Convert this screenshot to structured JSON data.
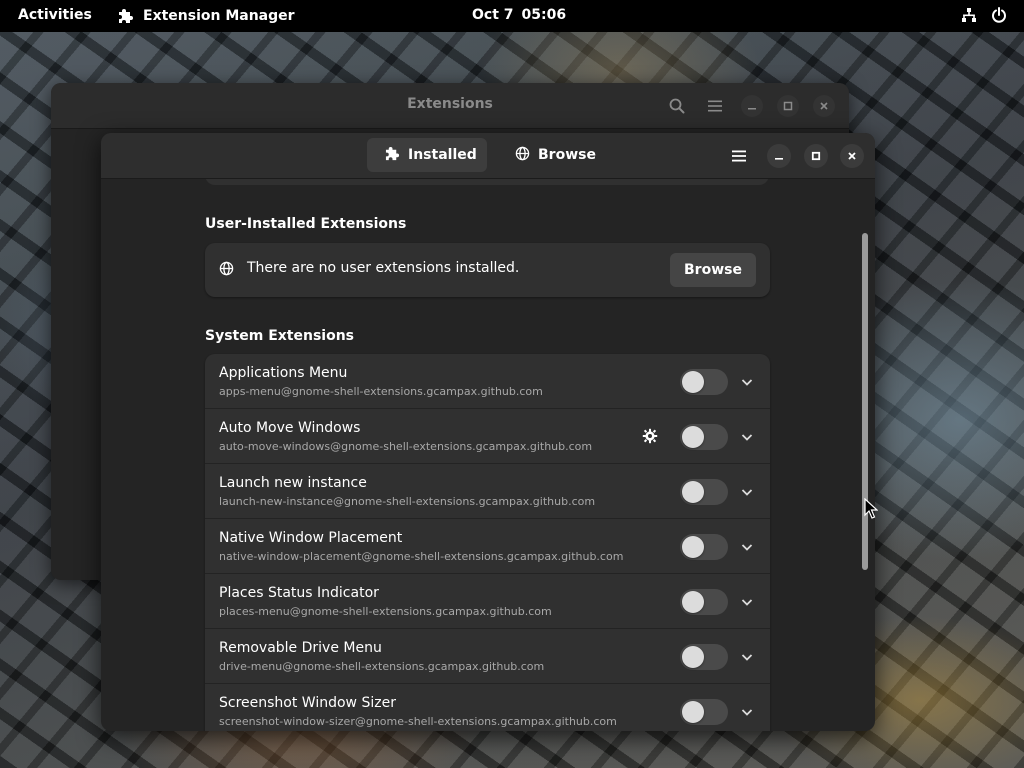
{
  "topbar": {
    "activities": "Activities",
    "app_name": "Extension Manager",
    "date": "Oct 7",
    "time": "05:06",
    "icons": [
      "puzzle-icon",
      "network-icon",
      "power-icon"
    ]
  },
  "back_window": {
    "title": "Extensions",
    "icons": [
      "search-icon",
      "menu-icon",
      "minimize-icon",
      "maximize-icon",
      "close-icon"
    ]
  },
  "front_window": {
    "tabs": [
      {
        "label": "Installed",
        "icon": "puzzle-icon",
        "active": true
      },
      {
        "label": "Browse",
        "icon": "globe-icon",
        "active": false
      }
    ],
    "header_icons": [
      "menu-icon",
      "minimize-icon",
      "maximize-icon",
      "close-icon"
    ],
    "user_section": {
      "title": "User-Installed Extensions",
      "empty_text": "There are no user extensions installed.",
      "browse_button": "Browse"
    },
    "system_section": {
      "title": "System Extensions",
      "extensions": [
        {
          "name": "Applications Menu",
          "uuid": "apps-menu@gnome-shell-extensions.gcampax.github.com",
          "enabled": false,
          "has_settings": false
        },
        {
          "name": "Auto Move Windows",
          "uuid": "auto-move-windows@gnome-shell-extensions.gcampax.github.com",
          "enabled": false,
          "has_settings": true
        },
        {
          "name": "Launch new instance",
          "uuid": "launch-new-instance@gnome-shell-extensions.gcampax.github.com",
          "enabled": false,
          "has_settings": false
        },
        {
          "name": "Native Window Placement",
          "uuid": "native-window-placement@gnome-shell-extensions.gcampax.github.com",
          "enabled": false,
          "has_settings": false
        },
        {
          "name": "Places Status Indicator",
          "uuid": "places-menu@gnome-shell-extensions.gcampax.github.com",
          "enabled": false,
          "has_settings": false
        },
        {
          "name": "Removable Drive Menu",
          "uuid": "drive-menu@gnome-shell-extensions.gcampax.github.com",
          "enabled": false,
          "has_settings": false
        },
        {
          "name": "Screenshot Window Sizer",
          "uuid": "screenshot-window-sizer@gnome-shell-extensions.gcampax.github.com",
          "enabled": false,
          "has_settings": false
        }
      ]
    }
  },
  "colors": {
    "window_bg": "#242424",
    "card_bg": "#303030",
    "header_bg": "#2e2e2e",
    "toggle_off": "#4a4a4a"
  }
}
